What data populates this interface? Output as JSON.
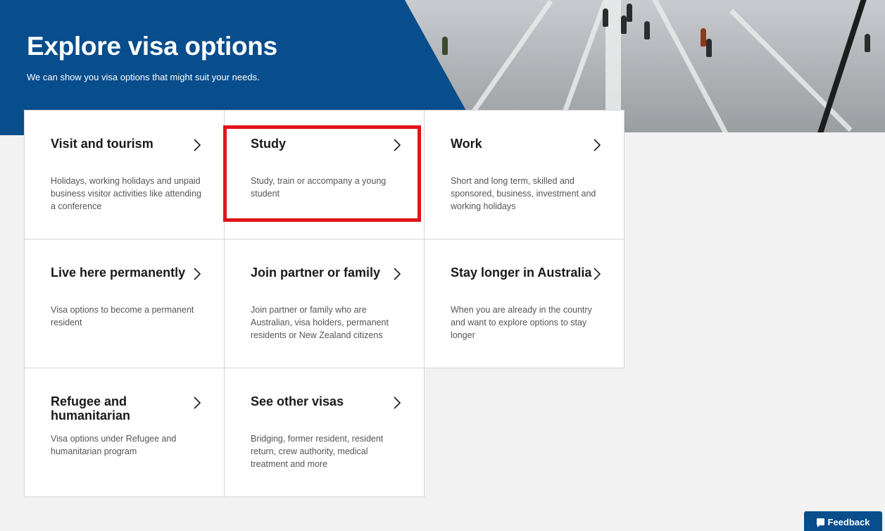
{
  "hero": {
    "title": "Explore visa options",
    "subtitle": "We can show you visa options that might suit your needs.",
    "banner_color": "#084d8c"
  },
  "cards": [
    {
      "title": "Visit and tourism",
      "description": "Holidays, working holidays and unpaid business visitor activities like attending a conference"
    },
    {
      "title": "Study",
      "description": "Study, train or accompany a young student"
    },
    {
      "title": "Work",
      "description": "Short and long term, skilled and sponsored, business, investment and working holidays"
    },
    {
      "title": "Live here permanently",
      "description": "Visa options to become a permanent resident"
    },
    {
      "title": "Join partner or family",
      "description": "Join partner or family who are Australian, visa holders, permanent residents or New Zealand citizens"
    },
    {
      "title": "Stay longer in Australia",
      "description": "When you are already in the country and want to explore options to stay longer"
    },
    {
      "title": "Refugee and humanitarian",
      "description": "Visa options under Refugee and humanitarian program"
    },
    {
      "title": "See other visas",
      "description": "Bridging, former resident, resident return, crew authority, medical treatment and more"
    }
  ],
  "highlight_color": "#e0151b",
  "feedback": {
    "label": "Feedback",
    "icon": "speech-bubble-icon"
  }
}
